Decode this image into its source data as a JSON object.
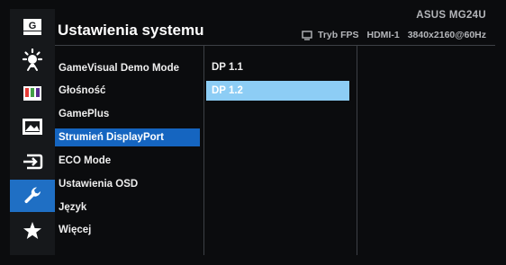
{
  "header": {
    "title": "Ustawienia systemu",
    "model": "ASUS  MG24U",
    "status": {
      "mode": "Tryb FPS",
      "input": "HDMI-1",
      "resolution": "3840x2160@60Hz"
    }
  },
  "sidebar": {
    "items": [
      {
        "icon": "gamevisual-g-icon",
        "active": false
      },
      {
        "icon": "blue-light-filter-icon",
        "active": false
      },
      {
        "icon": "color-bars-icon",
        "active": false
      },
      {
        "icon": "image-icon",
        "active": false
      },
      {
        "icon": "input-select-icon",
        "active": false
      },
      {
        "icon": "wrench-icon",
        "active": true
      },
      {
        "icon": "star-icon",
        "active": false
      }
    ]
  },
  "menu": {
    "items": [
      {
        "label": "GameVisual Demo Mode"
      },
      {
        "label": "Głośność"
      },
      {
        "label": "GamePlus"
      },
      {
        "label": "Strumień DisplayPort",
        "selected": true
      },
      {
        "label": "ECO Mode"
      },
      {
        "label": "Ustawienia OSD"
      },
      {
        "label": "Język"
      },
      {
        "label": "Więcej"
      }
    ]
  },
  "options": {
    "items": [
      {
        "label": "DP 1.1"
      },
      {
        "label": "DP 1.2",
        "selected": true
      }
    ]
  },
  "colors": {
    "active_tab": "#1f6fc4",
    "menu_selected": "#1565c0",
    "option_selected": "#8dcdf5",
    "background": "#0b0c0e"
  }
}
